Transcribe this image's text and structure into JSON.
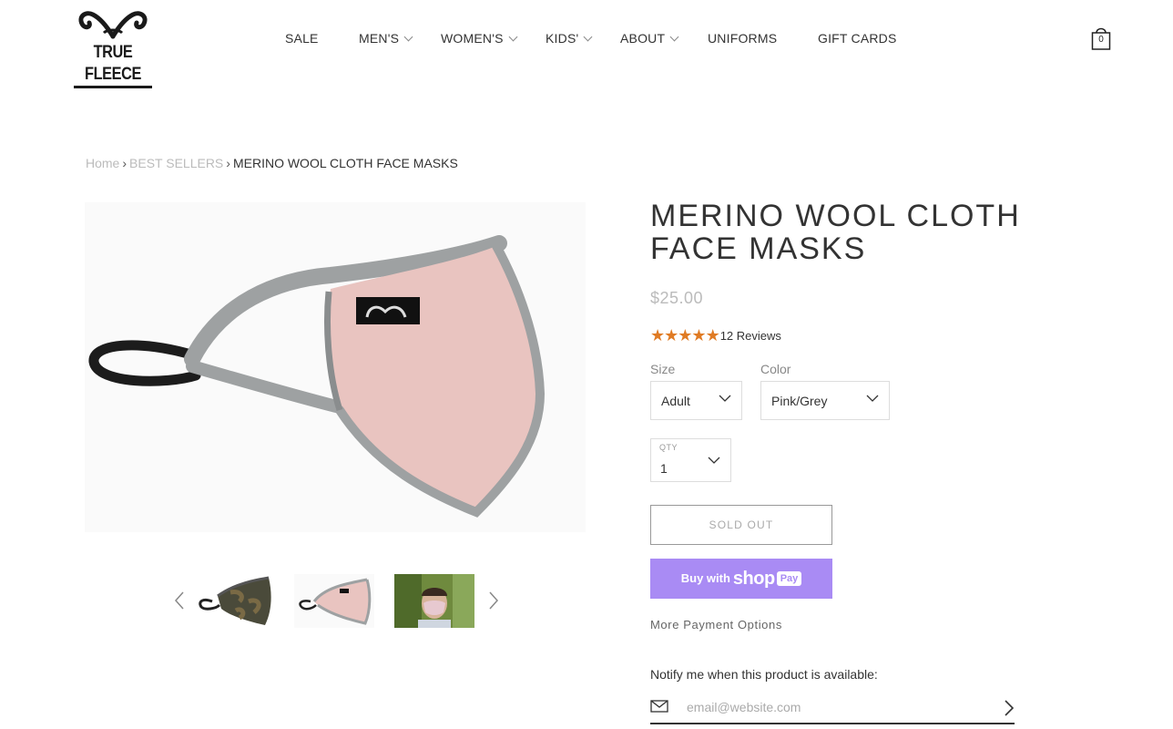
{
  "brand": {
    "logo_text": "TRUE FLEECE"
  },
  "nav": {
    "items": [
      {
        "label": "SALE",
        "has_dropdown": false
      },
      {
        "label": "MEN'S",
        "has_dropdown": true
      },
      {
        "label": "WOMEN'S",
        "has_dropdown": true
      },
      {
        "label": "KIDS'",
        "has_dropdown": true
      },
      {
        "label": "ABOUT",
        "has_dropdown": true
      },
      {
        "label": "UNIFORMS",
        "has_dropdown": false
      },
      {
        "label": "GIFT CARDS",
        "has_dropdown": false
      }
    ],
    "cart_count": "0"
  },
  "breadcrumb": {
    "home": "Home",
    "separator": "›",
    "category": "BEST SELLERS",
    "current": "MERINO WOOL CLOTH FACE MASKS"
  },
  "product": {
    "title": "MERINO WOOL CLOTH FACE MASKS",
    "price": "$25.00",
    "rating": 5,
    "review_count": "12 Reviews",
    "size_label": "Size",
    "size_value": "Adult",
    "color_label": "Color",
    "color_value": "Pink/Grey",
    "qty_label": "QTY",
    "qty_value": "1",
    "sold_out_label": "SOLD OUT",
    "shop_pay": {
      "buy_with": "Buy with",
      "shop": "shop",
      "pay": "Pay"
    },
    "more_payment_options": "More Payment Options",
    "notify_text": "Notify me when this product is available:",
    "email_placeholder": "email@website.com"
  },
  "gallery": {
    "thumbnails": [
      "camo mask",
      "pink/grey mask",
      "person wearing mask"
    ]
  },
  "colors": {
    "accent_star": "#e07b24",
    "shop_pay": "#a98bf4",
    "mask_pink": "#e9c4c0",
    "mask_trim": "#9ea1a2"
  },
  "icons": [
    "cart-icon",
    "chevron-down-icon",
    "chevron-left-icon",
    "chevron-right-icon",
    "mail-icon",
    "star-icon"
  ]
}
